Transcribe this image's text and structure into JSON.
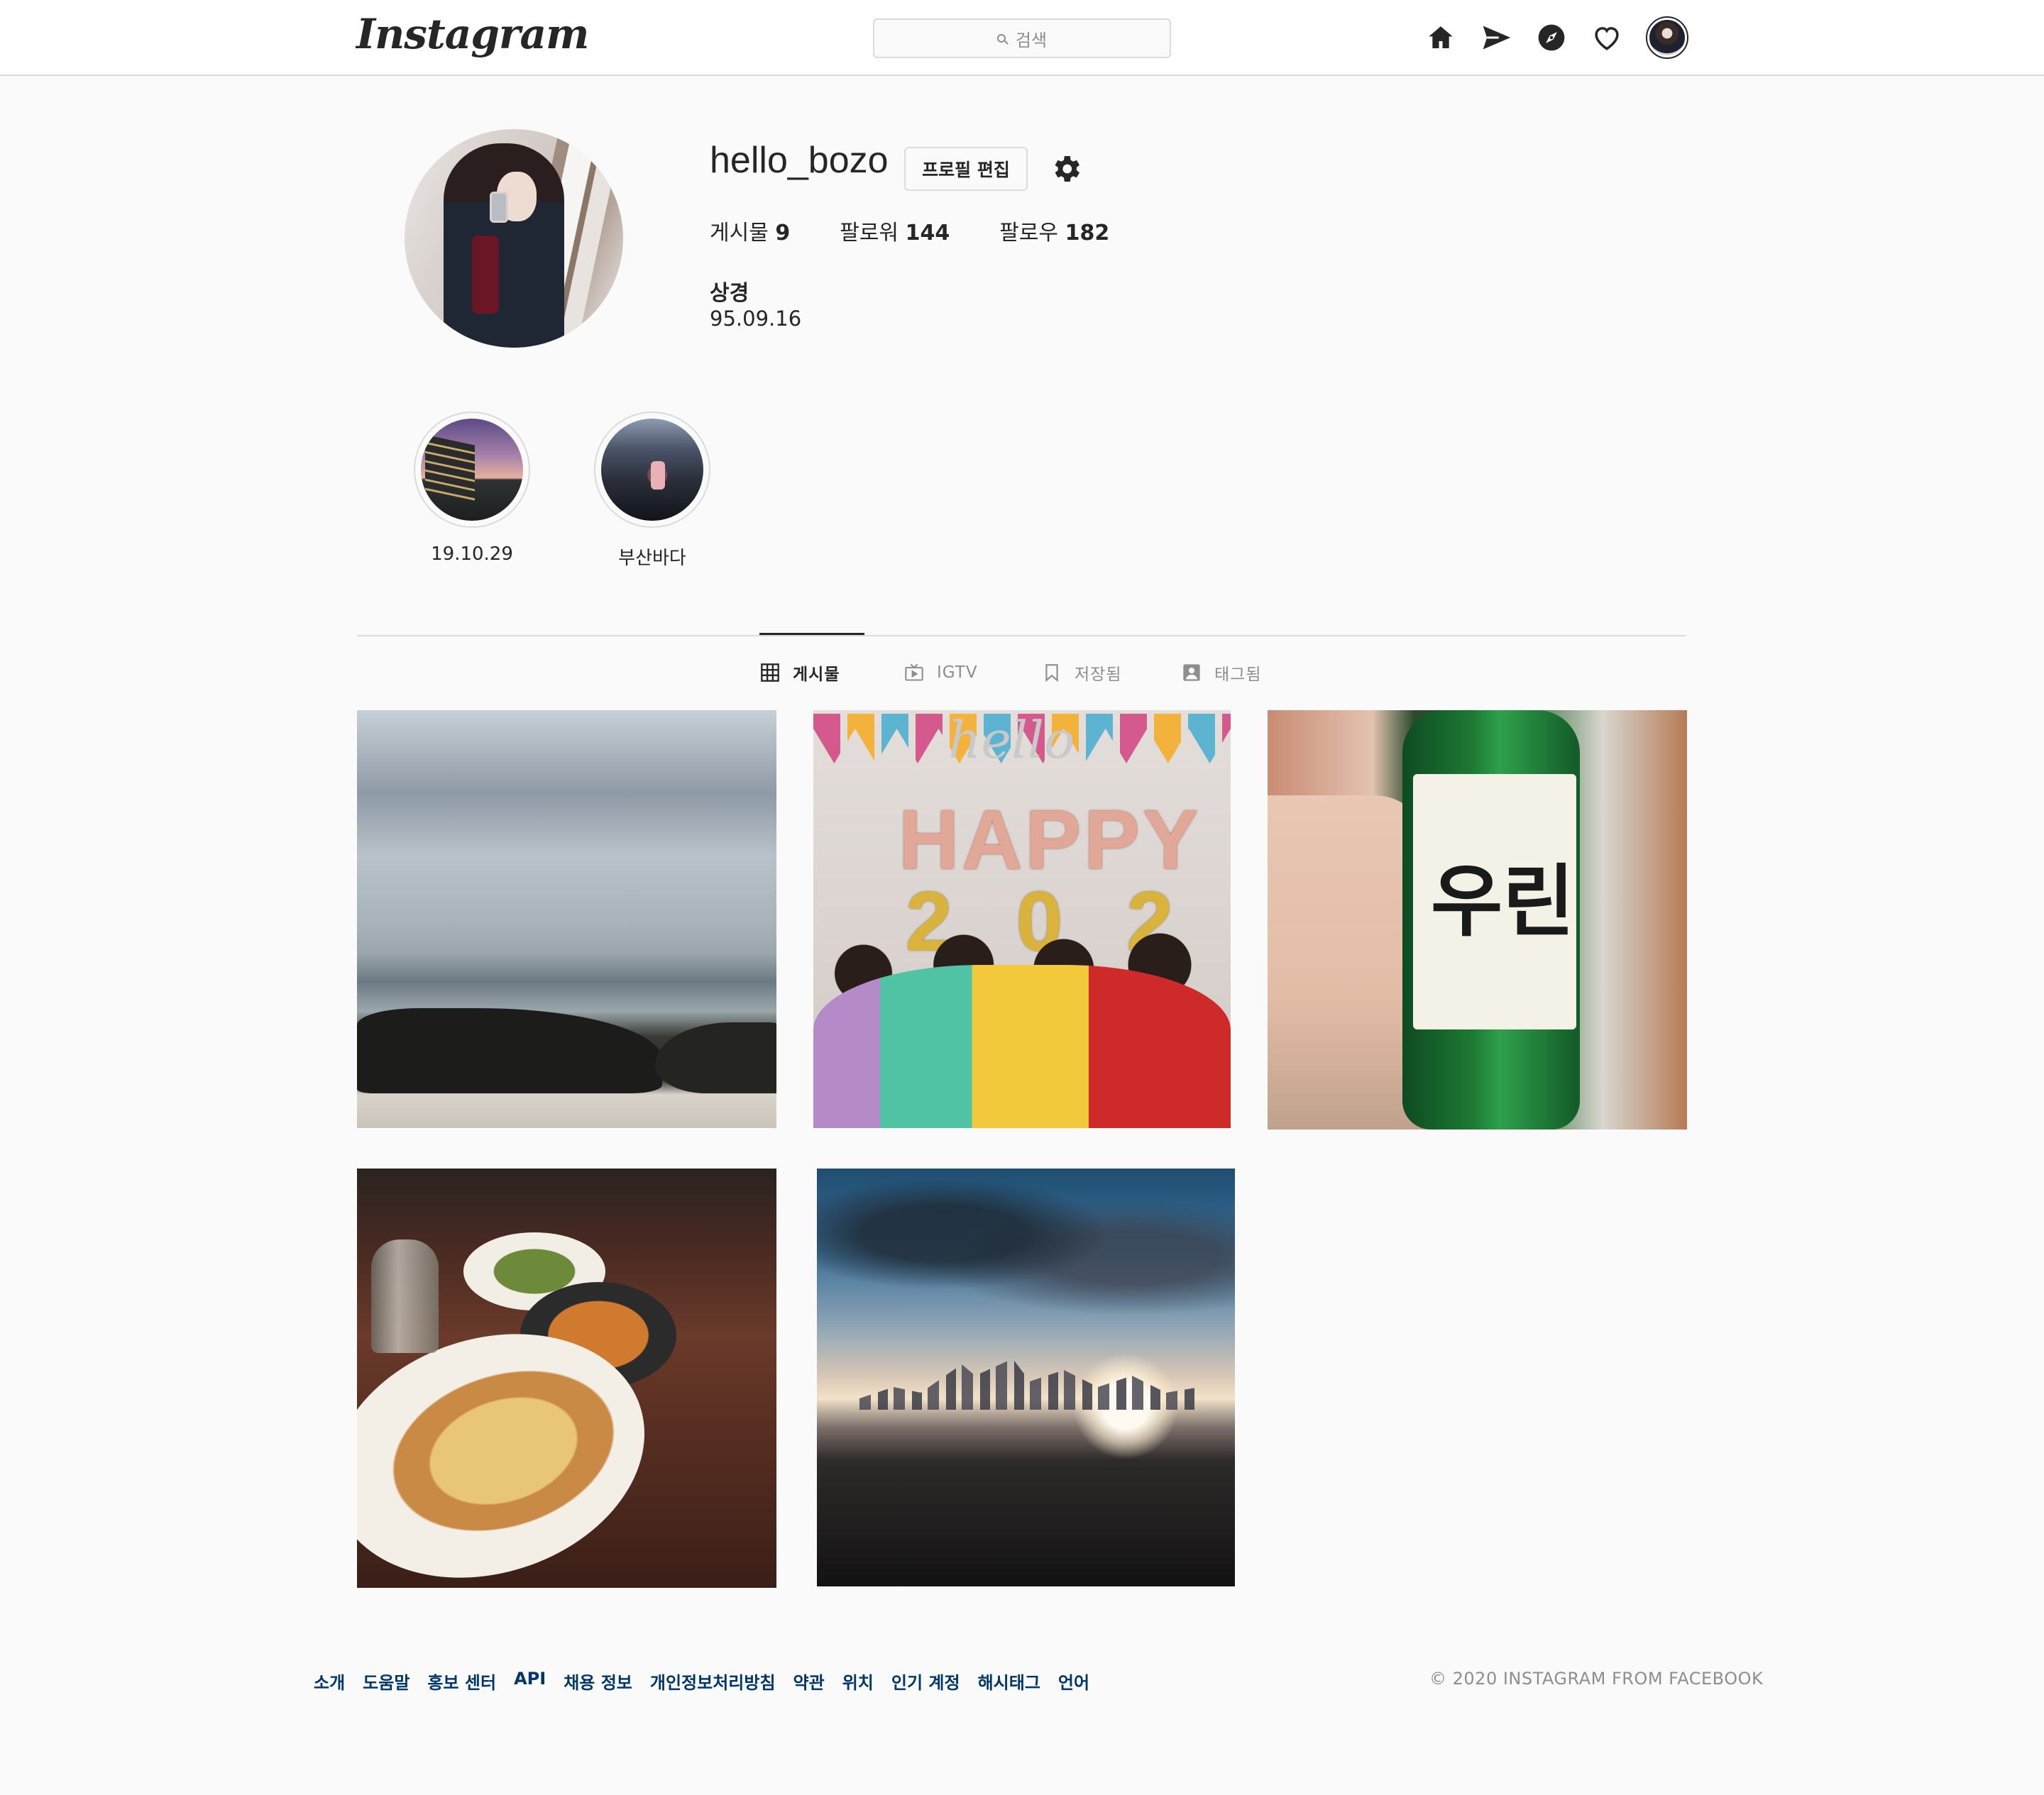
{
  "header": {
    "logo_text": "Instagram",
    "search_placeholder": "검색",
    "nav_icons": [
      "home-icon",
      "direct-icon",
      "explore-icon",
      "activity-heart-icon",
      "profile-avatar"
    ]
  },
  "profile": {
    "username": "hello_bozo",
    "edit_button_label": "프로필 편집",
    "stats": {
      "posts_label": "게시물",
      "posts_count": "9",
      "followers_label": "팔로워",
      "followers_count": "144",
      "following_label": "팔로우",
      "following_count": "182"
    },
    "full_name": "상경",
    "bio": "95.09.16"
  },
  "highlights": [
    {
      "label": "19.10.29"
    },
    {
      "label": "부산바다"
    }
  ],
  "tabs": [
    {
      "label": "게시물",
      "icon": "grid-icon",
      "active": true
    },
    {
      "label": "IGTV",
      "icon": "igtv-icon",
      "active": false
    },
    {
      "label": "저장됨",
      "icon": "bookmark-icon",
      "active": false
    },
    {
      "label": "태그됨",
      "icon": "tagged-icon",
      "active": false
    }
  ],
  "posts": [
    {
      "subject": "beach-rocks-cloudy-sky"
    },
    {
      "subject": "happy-2020-party"
    },
    {
      "subject": "soju-bottle-iije-urin"
    },
    {
      "subject": "restaurant-meal"
    },
    {
      "subject": "sunset-city-coast"
    }
  ],
  "post_texts": {
    "hello": "hello",
    "happy": "HAPPY",
    "year": "2020",
    "soju_label": "우린"
  },
  "footer": {
    "links": [
      "소개",
      "도움말",
      "홍보 센터",
      "API",
      "채용 정보",
      "개인정보처리방침",
      "약관",
      "위치",
      "인기 계정",
      "해시태그",
      "언어"
    ],
    "copyright": "© 2020 INSTAGRAM FROM FACEBOOK"
  },
  "colors": {
    "background": "#fafafa",
    "text": "#262626",
    "muted": "#8e8e8e",
    "border": "#dbdbdb",
    "link": "#00376b"
  }
}
